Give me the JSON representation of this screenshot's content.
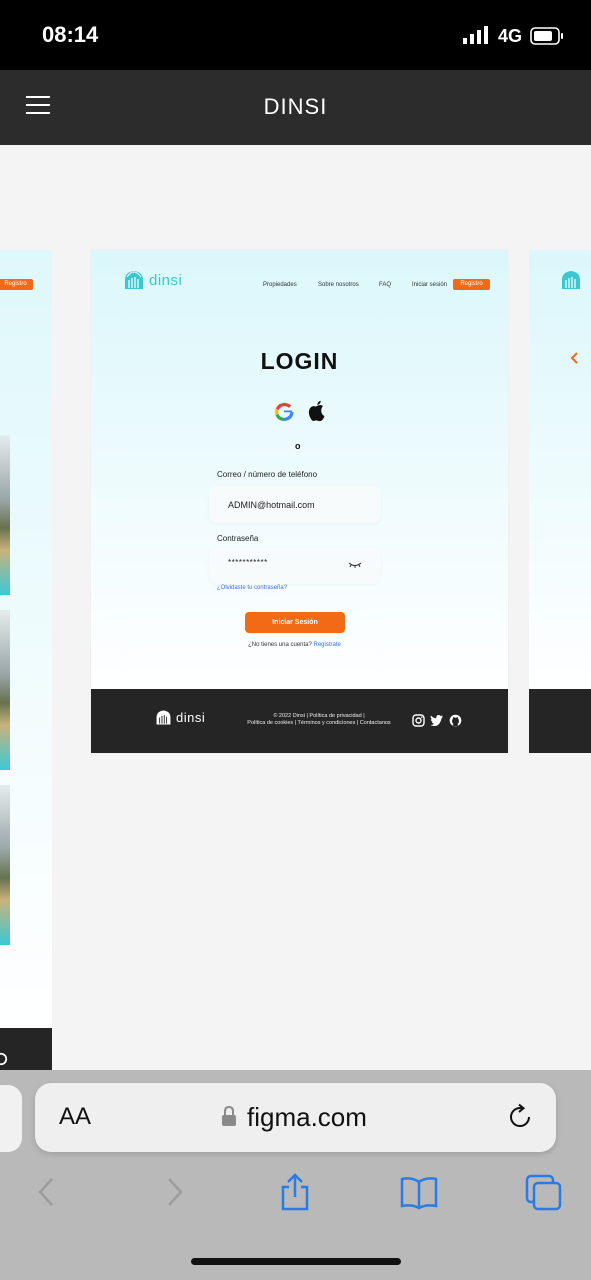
{
  "status_bar": {
    "time": "08:14",
    "network": "4G"
  },
  "figma": {
    "title": "DINSI"
  },
  "left_frame": {
    "register_label": "Registro"
  },
  "main_frame": {
    "logo_text": "dinsi",
    "nav": [
      "Propiedades",
      "Sobre nosotros",
      "FAQ",
      "Iniciar sesión"
    ],
    "nav_register": "Registro",
    "title": "LOGIN",
    "divider_mark": "o",
    "email_label": "Correo / número de teléfono",
    "email_value": "ADMIN@hotmail.com",
    "password_label": "Contraseña",
    "password_value": "***********",
    "forgot": "¿Olvidaste tu contraseña?",
    "login_button": "Iniciar Sesión",
    "no_account": "¿No tienes una cuenta?",
    "register_link": "Registrate",
    "footer_logo_text": "dinsi",
    "footer_line1": "© 2022 Dinsi | Política de privacidad |",
    "footer_line2": "Política de cookies | Términos y condiciones  |  Contactanos"
  },
  "safari": {
    "text_size_label": "AA",
    "domain": "figma.com"
  },
  "colors": {
    "accent": "#f26a16",
    "brand": "#3cc7cf",
    "footer": "#252525",
    "link": "#3a6fe8",
    "toolbar_icon": "#2a7be4"
  },
  "icons": [
    "menu-icon",
    "google-icon",
    "apple-icon",
    "eye-closed-icon",
    "instagram-icon",
    "twitter-icon",
    "github-icon",
    "lock-icon",
    "reload-icon",
    "back-icon",
    "forward-icon",
    "share-icon",
    "bookmarks-icon",
    "tabs-icon"
  ]
}
